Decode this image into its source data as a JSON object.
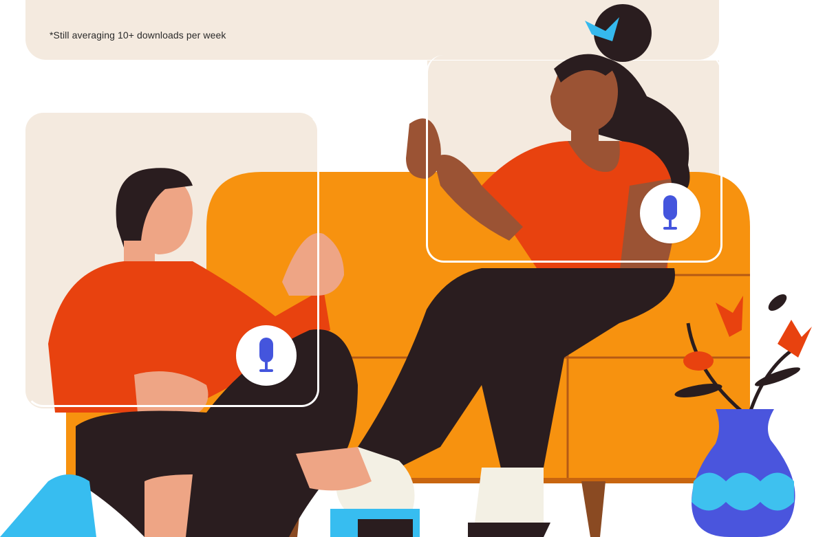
{
  "stats_card": {
    "footnote": "*Still averaging 10+ downloads per week"
  },
  "voice_cards": [
    {
      "mic_icon": "microphone-icon",
      "label": "left"
    },
    {
      "mic_icon": "microphone-icon",
      "label": "right"
    }
  ],
  "colors": {
    "card_beige": "#f4eadf",
    "sofa_orange": "#f7920f",
    "shirt_red": "#e8420f",
    "pants_dark": "#2a1d1f",
    "mic_blue": "#4455dd",
    "vase_blue": "#4a55dd",
    "vase_cyan": "#3ec1ef",
    "skin_light": "#eea585",
    "skin_dark": "#9b5334",
    "sock_cream": "#f3f0e4",
    "shoe_cyan": "#37bdf0"
  }
}
